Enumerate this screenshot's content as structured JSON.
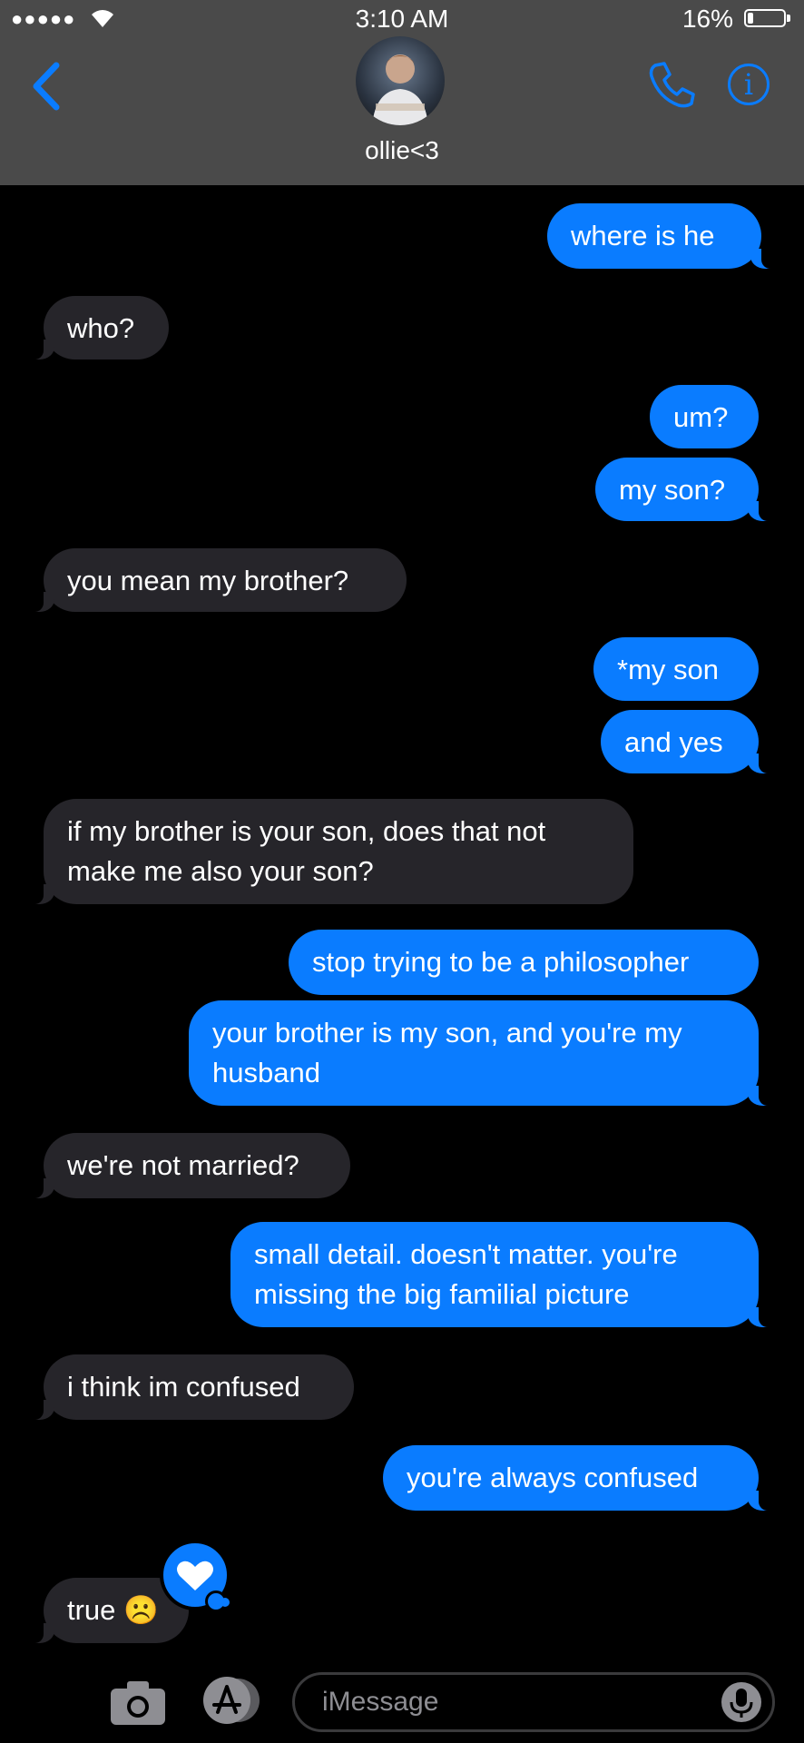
{
  "status_bar": {
    "signal": "●●●●●",
    "time": "3:10 AM",
    "battery_percent": "16%",
    "battery_level": 0.16
  },
  "header": {
    "contact_name": "ollie<3",
    "icons": {
      "back": "chevron-left-icon",
      "call": "phone-icon",
      "info": "info-icon"
    },
    "accent_color": "#0a7cff"
  },
  "messages": [
    {
      "from": "me",
      "text": "where is he"
    },
    {
      "from": "them",
      "text": "who?"
    },
    {
      "from": "me",
      "text": "um?"
    },
    {
      "from": "me",
      "text": "my son?"
    },
    {
      "from": "them",
      "text": "you mean my brother?"
    },
    {
      "from": "me",
      "text": "*my son"
    },
    {
      "from": "me",
      "text": "and yes"
    },
    {
      "from": "them",
      "text": "if my brother is your son, does that not\nmake me also your son?"
    },
    {
      "from": "me",
      "text": "stop trying to be a philosopher"
    },
    {
      "from": "me",
      "text": "your brother is my son, and you're my\nhusband"
    },
    {
      "from": "them",
      "text": "we're not married?"
    },
    {
      "from": "me",
      "text": "small detail. doesn't matter. you're\nmissing the big familial picture"
    },
    {
      "from": "them",
      "text": "i think im confused"
    },
    {
      "from": "me",
      "text": "you're always confused"
    },
    {
      "from": "them",
      "text": "true ☹️",
      "reaction": "heart-icon"
    }
  ],
  "input_bar": {
    "placeholder": "iMessage",
    "icons": {
      "camera": "camera-icon",
      "apps": "app-store-icon",
      "mic": "microphone-icon"
    }
  },
  "colors": {
    "sent_bubble": "#0a7cff",
    "received_bubble": "#26252a",
    "background": "#000000"
  }
}
